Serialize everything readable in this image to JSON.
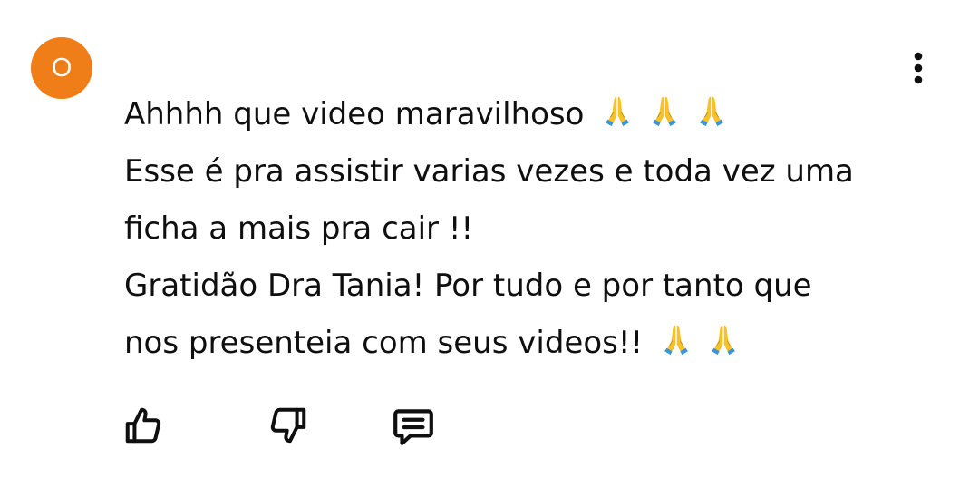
{
  "author": {
    "avatar_initial": "O",
    "avatar_color": "#ef7d18"
  },
  "comment": {
    "lines": [
      "Ahhhh que video maravilhoso",
      "Esse é pra assistir varias vezes e toda vez uma",
      "ficha a mais pra cair !!",
      "Gratidão Dra Tania! Por tudo e por tanto que",
      "nos presenteia com seus videos!!"
    ],
    "line_emojis": [
      [
        "folded-hands",
        "folded-hands",
        "folded-hands"
      ],
      [],
      [],
      [],
      [
        "folded-hands",
        "folded-hands"
      ]
    ]
  },
  "actions": {
    "like_icon": "thumbs-up-icon",
    "dislike_icon": "thumbs-down-icon",
    "reply_icon": "reply-comment-icon"
  },
  "menu": {
    "icon": "more-vertical-icon"
  },
  "colors": {
    "text": "#0f0f0f",
    "avatar": "#ef7d18",
    "emoji_skin": "#f7c12a",
    "emoji_sleeve": "#3b95d6"
  }
}
